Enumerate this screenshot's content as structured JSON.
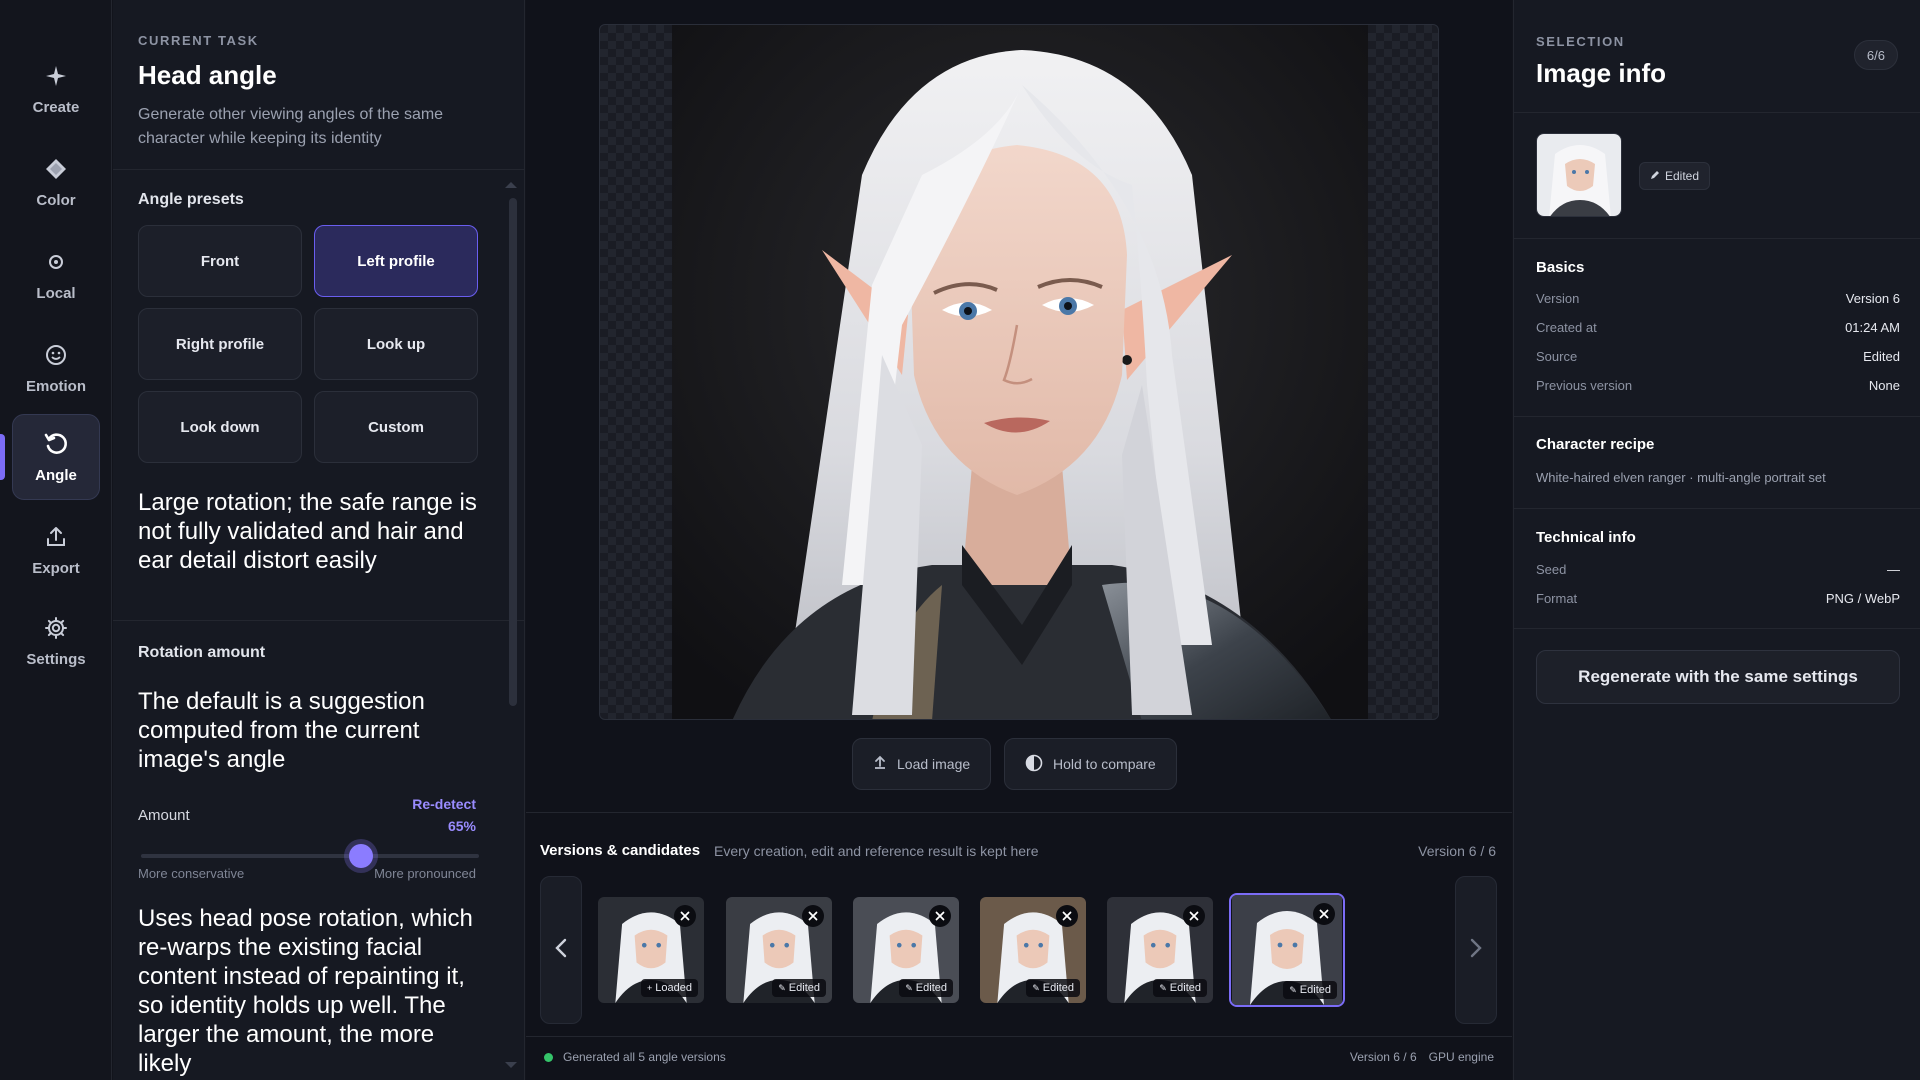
{
  "nav": {
    "items": [
      {
        "label": "Create",
        "icon": "sparkle-icon"
      },
      {
        "label": "Color",
        "icon": "diamond-icon"
      },
      {
        "label": "Local",
        "icon": "target-icon"
      },
      {
        "label": "Emotion",
        "icon": "smile-icon"
      },
      {
        "label": "Angle",
        "icon": "rotate-icon"
      },
      {
        "label": "Export",
        "icon": "upload-icon"
      },
      {
        "label": "Settings",
        "icon": "gear-icon"
      }
    ],
    "active": "Angle"
  },
  "task": {
    "eyebrow": "CURRENT TASK",
    "title": "Head angle",
    "description": "Generate other viewing angles of the same character while keeping its identity",
    "presets_label": "Angle presets",
    "presets": [
      "Front",
      "Left profile",
      "Right profile",
      "Look up",
      "Look down",
      "Custom"
    ],
    "active_preset": "Left profile",
    "warning": "Large rotation; the safe range is not fully validated and hair and ear detail distort easily",
    "rotation_label": "Rotation amount",
    "rotation_hint": "The default is a suggestion computed from the current image's angle",
    "amount_label": "Amount",
    "redetect_label": "Re-detect",
    "amount_value": "65%",
    "amount_fraction": 0.65,
    "slider_min_label": "More conservative",
    "slider_max_label": "More pronounced",
    "method_note": "Uses head pose rotation, which re-warps the existing facial content instead of repainting it, so identity holds up well. The larger the amount, the more likely"
  },
  "canvas": {
    "load_button": "Load image",
    "compare_button": "Hold to compare"
  },
  "versions": {
    "title": "Versions & candidates",
    "subtitle": "Every creation, edit and reference result is kept here",
    "counter": "Version 6 / 6",
    "items": [
      {
        "tag": "Loaded",
        "tag_icon": "plus-icon"
      },
      {
        "tag": "Edited",
        "tag_icon": "pencil-icon"
      },
      {
        "tag": "Edited",
        "tag_icon": "pencil-icon"
      },
      {
        "tag": "Edited",
        "tag_icon": "pencil-icon"
      },
      {
        "tag": "Edited",
        "tag_icon": "pencil-icon"
      },
      {
        "tag": "Edited",
        "tag_icon": "pencil-icon"
      }
    ],
    "active_index": 5
  },
  "status": {
    "message": "Generated all 5 angle versions",
    "version": "Version 6 / 6",
    "engine": "GPU engine",
    "color": "#35c46a"
  },
  "info": {
    "eyebrow": "SELECTION",
    "title": "Image info",
    "count": "6/6",
    "chip": "Edited",
    "basics_title": "Basics",
    "basics": [
      {
        "k": "Version",
        "v": "Version 6"
      },
      {
        "k": "Created at",
        "v": "01:24 AM"
      },
      {
        "k": "Source",
        "v": "Edited"
      },
      {
        "k": "Previous version",
        "v": "None"
      }
    ],
    "recipe_title": "Character recipe",
    "recipe": "White-haired elven ranger · multi-angle portrait set",
    "tech_title": "Technical info",
    "tech": [
      {
        "k": "Seed",
        "v": "—"
      },
      {
        "k": "Format",
        "v": "PNG / WebP"
      }
    ],
    "regen_button": "Regenerate with the same settings"
  },
  "colors": {
    "accent": "#7c6cf6",
    "accent_text": "#9a8cff",
    "background": "#12141c",
    "panel": "#161922"
  }
}
